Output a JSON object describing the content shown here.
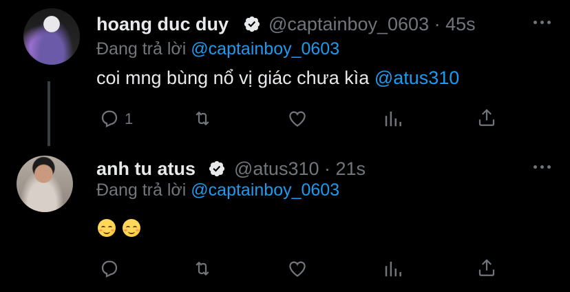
{
  "tweets": [
    {
      "name": "hoang duc duy",
      "handle_time": "@captainboy_0603 · 45s",
      "reply_prefix": "Đang trả lời",
      "reply_to": "@captainboy_0603",
      "text": "coi mng bùng nổ vị giác chưa kìa",
      "text_mention": "@atus310",
      "reply_count": "1"
    },
    {
      "name": "anh tu atus",
      "handle_time": "@atus310 · 21s",
      "reply_prefix": "Đang trả lời",
      "reply_to": "@captainboy_0603",
      "emojis": [
        "smiling-face-emoji",
        "smiling-face-emoji"
      ]
    }
  ],
  "colors": {
    "background": "#000000",
    "primary_text": "#e7e9ea",
    "secondary_text": "#71767b",
    "link": "#1d9bf0"
  },
  "icons": [
    "reply-icon",
    "retweet-icon",
    "like-icon",
    "analytics-icon",
    "share-icon",
    "more-icon",
    "verified-icon"
  ]
}
